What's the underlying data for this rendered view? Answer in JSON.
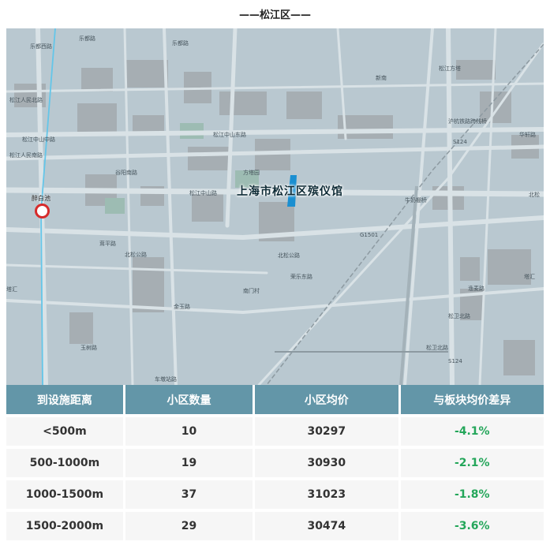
{
  "title": "——松江区——",
  "map": {
    "poi_name": "上海市松江区殡仪馆",
    "station_name": "醉白池",
    "labels": [
      "乐都路",
      "乐都西路",
      "乐都路",
      "松江人民北路",
      "松江中山中路",
      "松江人民南路",
      "松江中山东路",
      "谷阳南路",
      "方塔园",
      "松江中山路",
      "沪杭铁路跨线桥",
      "新南",
      "华轩路",
      "松江方塔",
      "牛奶棚桥",
      "北松公路",
      "南门村",
      "荣乐东路",
      "松卫北路",
      "渔麦路",
      "金玉路",
      "塔汇",
      "玉树路",
      "车墩站路",
      "G1501",
      "北松公路",
      "松卫北路",
      "茸平路",
      "S124",
      "S124",
      "北松",
      "塔汇"
    ]
  },
  "table": {
    "headers": [
      "到设施距离",
      "小区数量",
      "小区均价",
      "与板块均价差异"
    ],
    "rows": [
      {
        "distance": "<500m",
        "count": "10",
        "price": "30297",
        "diff": "-4.1%"
      },
      {
        "distance": "500-1000m",
        "count": "19",
        "price": "30930",
        "diff": "-2.1%"
      },
      {
        "distance": "1000-1500m",
        "count": "37",
        "price": "31023",
        "diff": "-1.8%"
      },
      {
        "distance": "1500-2000m",
        "count": "29",
        "price": "30474",
        "diff": "-3.6%"
      }
    ]
  },
  "colors": {
    "header_bg": "#6396a8",
    "diff_green": "#24a65a",
    "station_red": "#d62b2b",
    "poi_blue": "#1a8fd1"
  }
}
